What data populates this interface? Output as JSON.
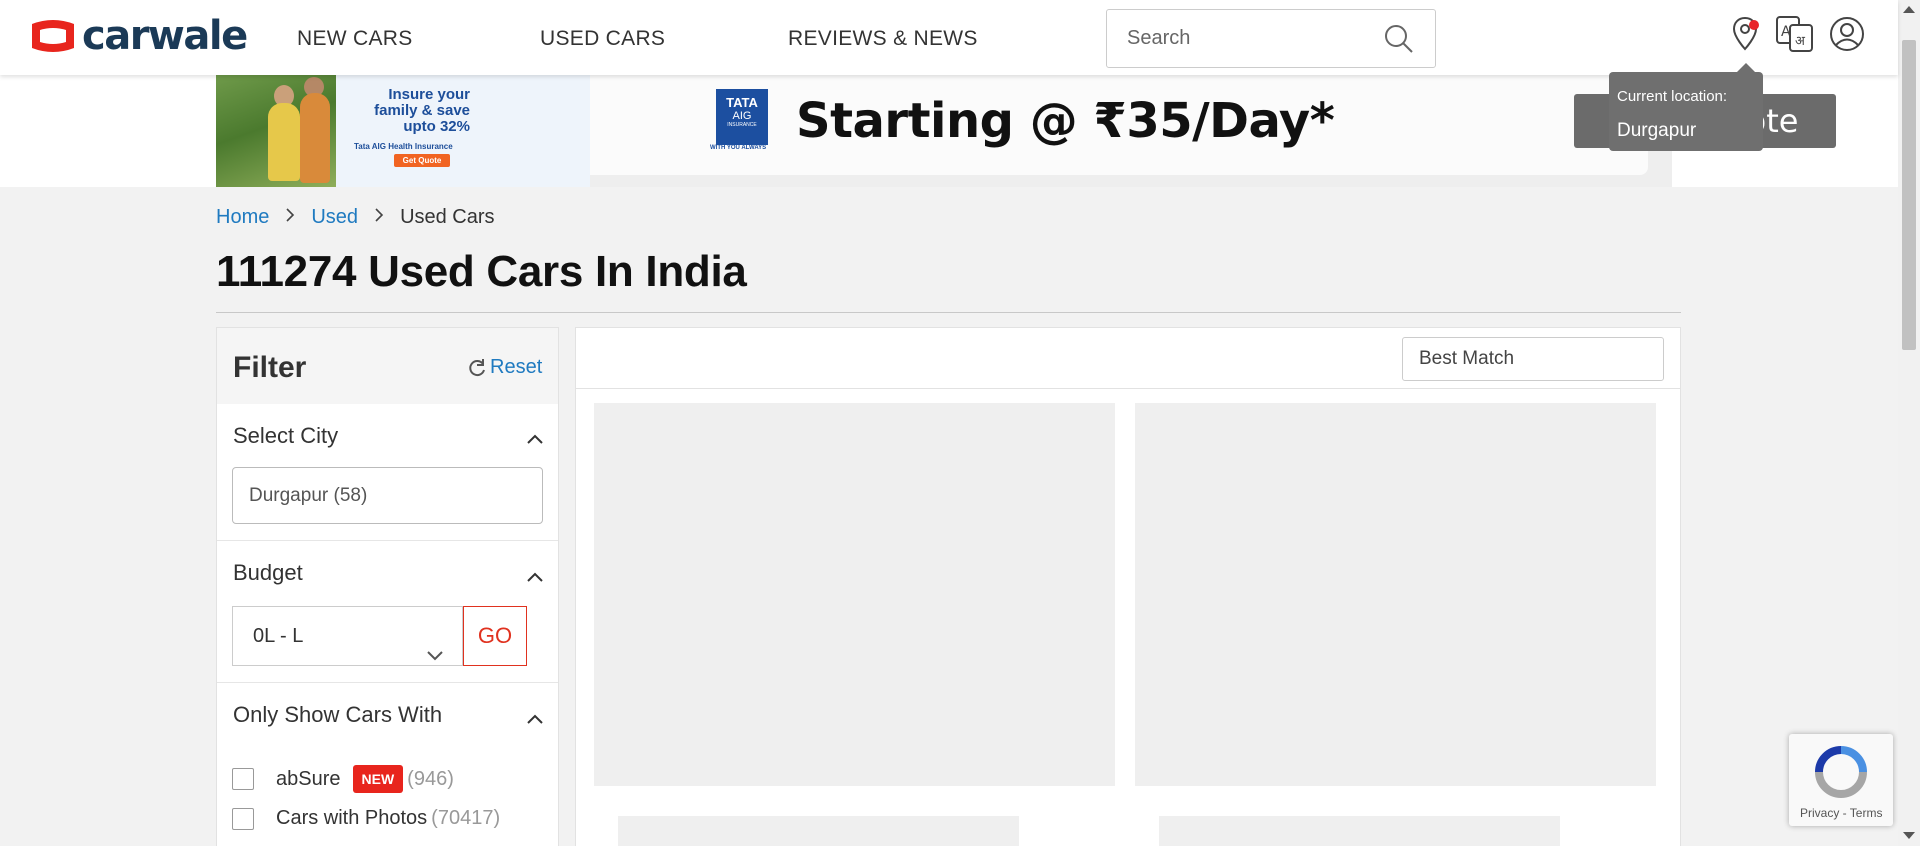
{
  "header": {
    "logo_text": "carwale",
    "nav": [
      "NEW CARS",
      "USED CARS",
      "REVIEWS & NEWS"
    ],
    "search_placeholder": "Search"
  },
  "location_tooltip": {
    "label": "Current location:",
    "city": "Durgapur"
  },
  "banner": {
    "card_text": "Insure your family & save upto 32%",
    "card_sub": "Tata AIG Health Insurance",
    "card_button": "Get Quote",
    "logo_line1": "TATA",
    "logo_line2": "AIG",
    "logo_line3": "INSURANCE",
    "logo_tagline": "WITH YOU ALWAYS",
    "headline": "Starting @ ₹35/Day*",
    "cta": "Get Quote"
  },
  "breadcrumb": {
    "home": "Home",
    "used": "Used",
    "current": "Used Cars"
  },
  "page_title": "111274 Used Cars In India",
  "filter": {
    "title": "Filter",
    "reset": "Reset",
    "city_section": "Select City",
    "city_value": "Durgapur (58)",
    "budget_section": "Budget",
    "budget_value": "0L - L",
    "go_label": "GO",
    "only_show_section": "Only Show Cars With",
    "options": [
      {
        "label": "abSure",
        "badge": "NEW",
        "count": "(946)"
      },
      {
        "label": "Cars with Photos",
        "count": "(70417)"
      }
    ]
  },
  "results": {
    "sort_value": "Best Match"
  },
  "recaptcha": {
    "links": "Privacy - Terms"
  },
  "colors": {
    "brand_red": "#e8251d",
    "brand_navy": "#1b3a57",
    "link_blue": "#1f7ac0"
  }
}
